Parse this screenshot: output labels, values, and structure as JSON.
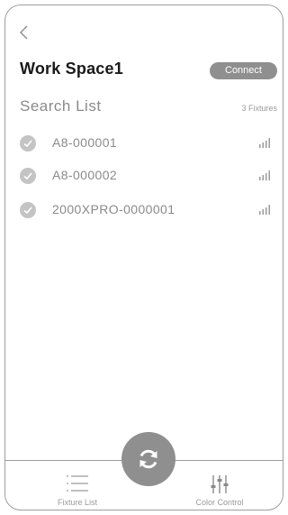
{
  "header": {
    "back_icon": "chevron-left-icon",
    "title": "Work Space1",
    "connect_label": "Connect"
  },
  "search": {
    "label": "Search List",
    "count": "3 Fixtures"
  },
  "fixtures": [
    {
      "name": "A8-000001",
      "selected": true,
      "signal": "signal-icon"
    },
    {
      "name": "A8-000002",
      "selected": true,
      "signal": "signal-icon"
    },
    {
      "name": "2000XPRO-0000001",
      "selected": true,
      "signal": "signal-icon"
    }
  ],
  "tabbar": {
    "fixture_list_label": "Fixture List",
    "color_control_label": "Color Control",
    "refresh_icon": "refresh-icon"
  },
  "colors": {
    "accent_gray": "#8f8f8f",
    "check_gray": "#c4c4c4",
    "text_dark": "#1a1a1a",
    "text_muted": "#8a8a8a"
  }
}
